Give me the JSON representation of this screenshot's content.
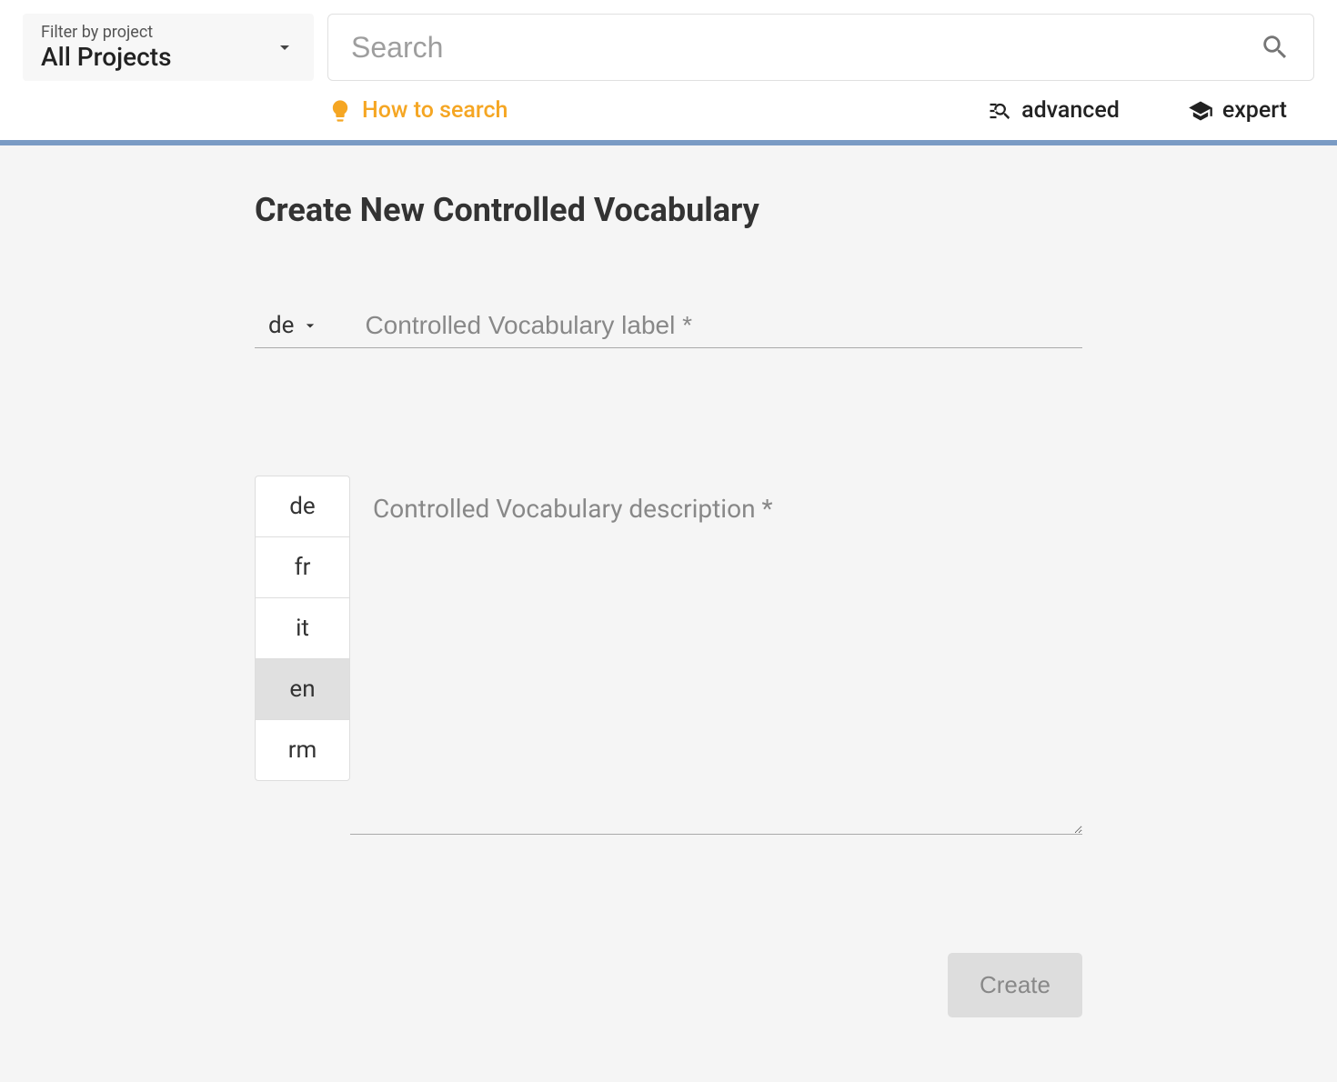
{
  "header": {
    "filter": {
      "label": "Filter by project",
      "value": "All Projects"
    },
    "search": {
      "placeholder": "Search"
    },
    "links": {
      "how_to_search": "How to search",
      "advanced": "advanced",
      "expert": "expert"
    }
  },
  "main": {
    "title": "Create New Controlled Vocabulary",
    "label_field": {
      "selected_lang": "de",
      "placeholder": "Controlled Vocabulary label *"
    },
    "description_field": {
      "languages": [
        "de",
        "fr",
        "it",
        "en",
        "rm"
      ],
      "hovered_index": 3,
      "placeholder": "Controlled Vocabulary description *"
    },
    "create_button_label": "Create"
  }
}
